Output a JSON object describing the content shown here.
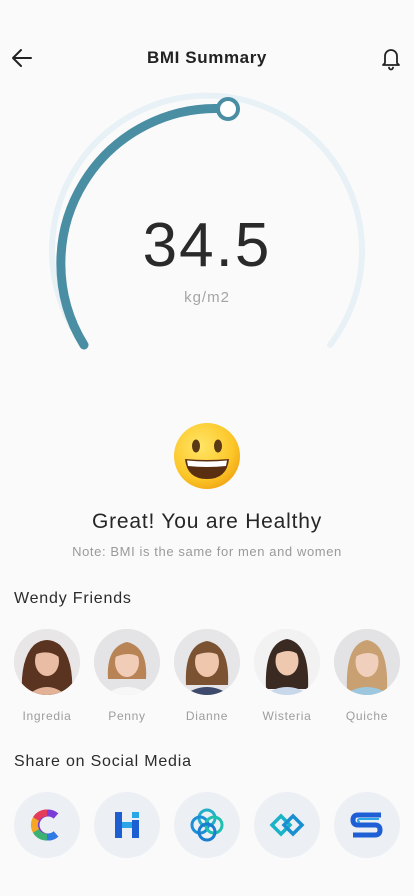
{
  "header": {
    "title": "BMI Summary",
    "back_icon": "arrow-left-icon",
    "notification_icon": "bell-icon"
  },
  "gauge": {
    "value": "34.5",
    "unit": "kg/m2",
    "progress_fraction": 0.55,
    "active_color": "#4a8ea3",
    "track_color": "#e8f1f6"
  },
  "result": {
    "emoji": "grinning-face",
    "status": "Great! You are Healthy",
    "note": "Note: BMI is the same for men and women"
  },
  "friends": {
    "title": "Wendy Friends",
    "items": [
      {
        "name": "Ingredia"
      },
      {
        "name": "Penny"
      },
      {
        "name": "Dianne"
      },
      {
        "name": "Wisteria"
      },
      {
        "name": "Quiche"
      }
    ]
  },
  "social": {
    "title": "Share on Social Media",
    "items": [
      {
        "icon": "rainbow-c-logo-icon"
      },
      {
        "icon": "blue-h-logo-icon"
      },
      {
        "icon": "interlocked-rings-logo-icon"
      },
      {
        "icon": "diamond-chain-logo-icon"
      },
      {
        "icon": "blue-s-logo-icon"
      }
    ]
  }
}
